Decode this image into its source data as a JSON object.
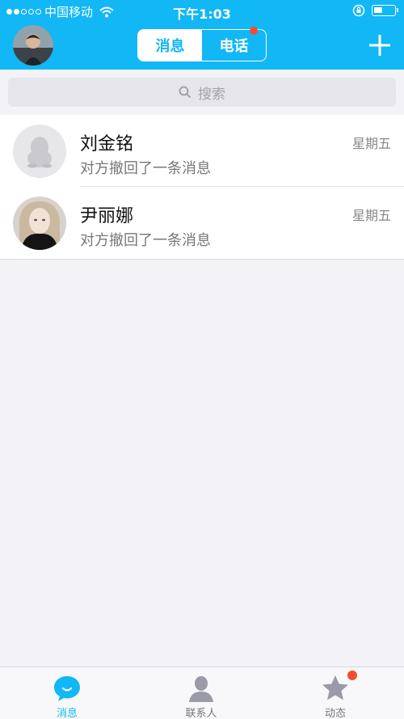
{
  "status_bar": {
    "carrier": "中国移动",
    "time": "下午1:03"
  },
  "header": {
    "tabs": [
      {
        "label": "消息",
        "active": true
      },
      {
        "label": "电话",
        "active": false,
        "has_badge": true
      }
    ]
  },
  "search": {
    "placeholder": "搜索"
  },
  "conversations": [
    {
      "name": "刘金铭",
      "preview": "对方撤回了一条消息",
      "time": "星期五",
      "avatar": "default-penguin"
    },
    {
      "name": "尹丽娜",
      "preview": "对方撤回了一条消息",
      "time": "星期五",
      "avatar": "photo"
    }
  ],
  "tabbar": {
    "items": [
      {
        "label": "消息",
        "icon": "chat-bubble-icon",
        "active": true
      },
      {
        "label": "联系人",
        "icon": "contacts-icon",
        "active": false
      },
      {
        "label": "动态",
        "icon": "star-icon",
        "active": false,
        "has_badge": true
      }
    ]
  },
  "colors": {
    "accent": "#12b7f5",
    "badge": "#f74c31"
  }
}
